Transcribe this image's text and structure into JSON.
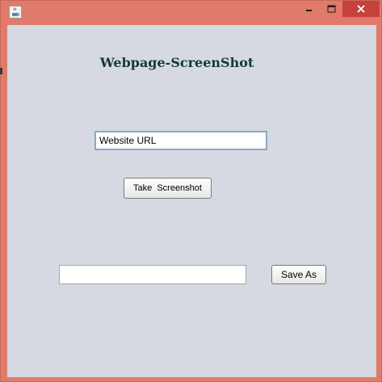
{
  "window": {
    "title_bar_buttons": {
      "minimize_icon": "minimize-icon",
      "maximize_icon": "maximize-icon",
      "close_icon": "close-icon"
    },
    "app_icon": "java-cup-icon",
    "frame_color": "#e07a6a",
    "close_color": "#c7413b"
  },
  "main": {
    "title": "Webpage-ScreenShot",
    "url_input": {
      "value": "Website URL",
      "placeholder": ""
    },
    "take_screenshot_label": "Take  Screenshot",
    "save_path_input": {
      "value": "",
      "placeholder": ""
    },
    "save_as_label": "Save As",
    "background_color": "#d6d9e1",
    "title_color": "#133a3a"
  }
}
